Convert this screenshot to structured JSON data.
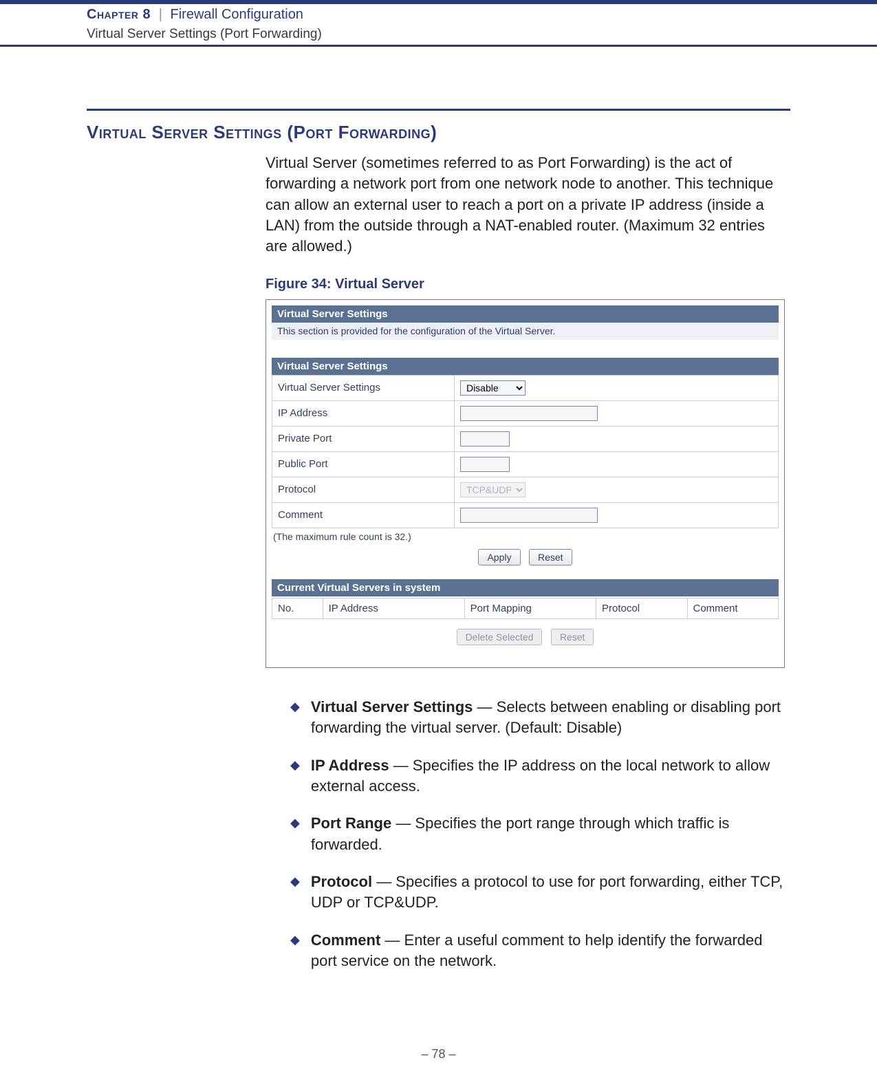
{
  "header": {
    "chapter_label": "Chapter 8",
    "chapter_title": "Firewall Configuration",
    "subtitle": "Virtual Server Settings (Port Forwarding)"
  },
  "section_title": "Virtual Server Settings (Port Forwarding)",
  "intro": "Virtual Server (sometimes referred to as Port Forwarding) is the act of forwarding a network port from one network node to another. This technique can allow an external user to reach a port on a private IP address (inside a LAN) from the outside through a NAT-enabled router. (Maximum 32 entries are allowed.)",
  "figure_label": "Figure 34:  Virtual Server",
  "shot": {
    "panel1_title": "Virtual Server Settings",
    "panel1_desc": "This section is provided for the configuration of the Virtual Server.",
    "panel2_title": "Virtual Server Settings",
    "rows": {
      "vss_label": "Virtual Server Settings",
      "vss_value": "Disable",
      "ip_label": "IP Address",
      "ip_value": "",
      "priv_label": "Private Port",
      "priv_value": "",
      "pub_label": "Public Port",
      "pub_value": "",
      "proto_label": "Protocol",
      "proto_value": "TCP&UDP",
      "comment_label": "Comment",
      "comment_value": ""
    },
    "note": "(The maximum rule count is 32.)",
    "btn_apply": "Apply",
    "btn_reset": "Reset",
    "panel3_title": "Current Virtual Servers in system",
    "cols": {
      "no": "No.",
      "ip": "IP Address",
      "port": "Port Mapping",
      "proto": "Protocol",
      "comment": "Comment"
    },
    "btn_delete": "Delete Selected",
    "btn_reset2": "Reset"
  },
  "defs": [
    {
      "term": "Virtual Server Settings",
      "text": " — Selects between enabling or disabling port forwarding the virtual server. (Default: Disable)"
    },
    {
      "term": "IP Address",
      "text": " — Specifies the IP address on the local network to allow external access."
    },
    {
      "term": "Port Range",
      "text": " — Specifies the port range through which traffic is forwarded."
    },
    {
      "term": "Protocol",
      "text": " — Specifies a protocol to use for port forwarding, either TCP, UDP or TCP&UDP."
    },
    {
      "term": "Comment",
      "text": " — Enter a useful comment to help identify the forwarded port service on the network."
    }
  ],
  "page_number": "–  78  –"
}
